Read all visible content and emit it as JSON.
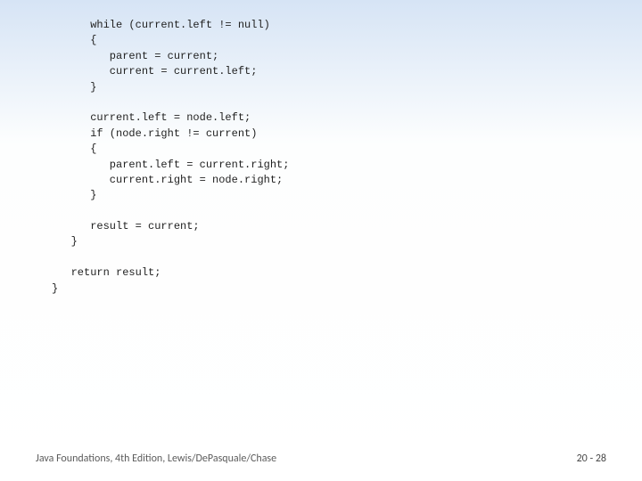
{
  "code": {
    "lines": [
      "      while (current.left != null)",
      "      {",
      "         parent = current;",
      "         current = current.left;",
      "      }",
      "",
      "      current.left = node.left;",
      "      if (node.right != current)",
      "      {",
      "         parent.left = current.right;",
      "         current.right = node.right;",
      "      }",
      "",
      "      result = current;",
      "   }",
      "",
      "   return result;",
      "}"
    ]
  },
  "footer": {
    "left": "Java Foundations, 4th Edition, Lewis/DePasquale/Chase",
    "right": "20 - 28"
  }
}
